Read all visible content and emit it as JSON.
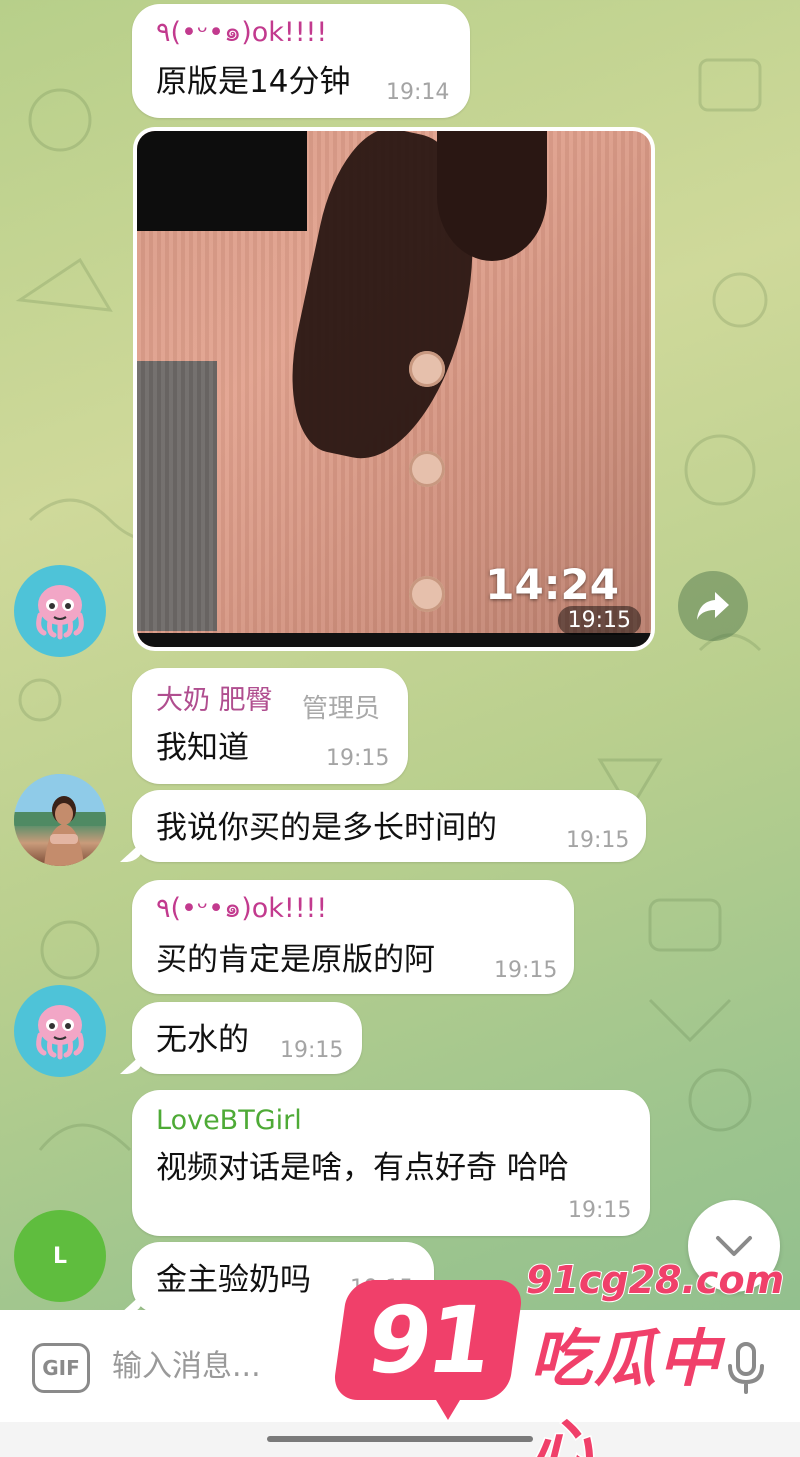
{
  "colors": {
    "sender_nickname": "#c23a8e",
    "sender_admin": "#b04e8f",
    "sender_lovebt": "#4eaa36",
    "watermark": "#f0406a"
  },
  "messages": [
    {
      "sender": "٩(•ᵕ•๑)ok!!!!",
      "text": "原版是14分钟",
      "time": "19:14"
    },
    {
      "type": "video",
      "duration": "14:24",
      "time": "19:15"
    },
    {
      "sender": "大奶 肥臀",
      "role": "管理员",
      "text": "我知道",
      "time": "19:15"
    },
    {
      "text": "我说你买的是多长时间的",
      "time": "19:15"
    },
    {
      "sender": "٩(•ᵕ•๑)ok!!!!",
      "text": "买的肯定是原版的阿",
      "time": "19:15"
    },
    {
      "text": "无水的",
      "time": "19:15"
    },
    {
      "sender": "LoveBTGirl",
      "text": "视频对话是啥，有点好奇 哈哈",
      "time": "19:15"
    },
    {
      "text": "金主验奶吗",
      "time": "19:15"
    }
  ],
  "avatars": {
    "letter_user": "L"
  },
  "icons": {
    "forward": "forward-arrow-icon",
    "scroll_down": "chevron-down-icon",
    "gif": "gif-icon",
    "mic": "microphone-icon"
  },
  "input": {
    "gif_label": "GIF",
    "placeholder": "输入消息..."
  },
  "watermark": {
    "logo": "91",
    "domain": "91cg28.com",
    "name": "吃瓜中心"
  }
}
